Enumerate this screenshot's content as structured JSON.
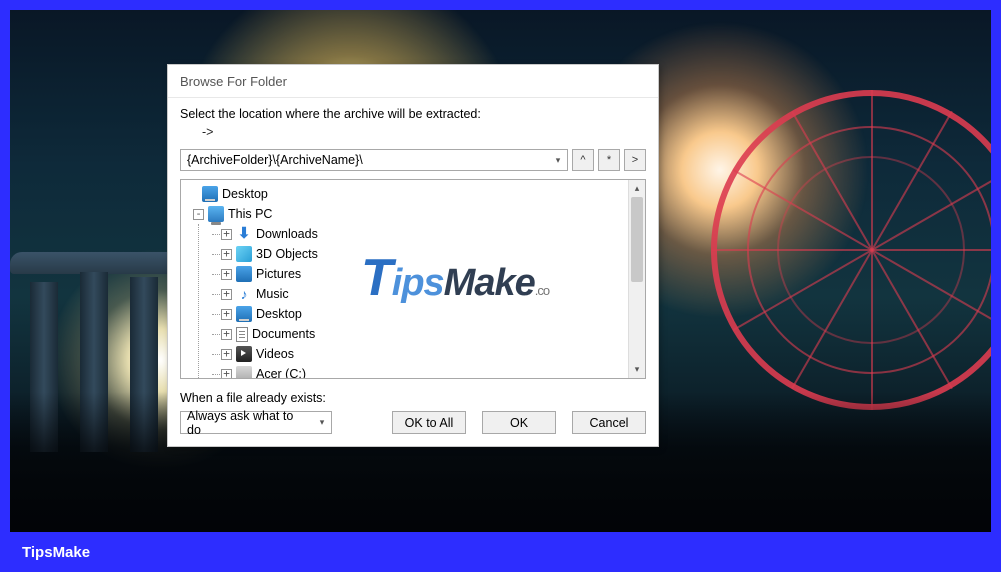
{
  "caption": "TipsMake",
  "watermark": {
    "t": "T",
    "ips": "ips",
    "make": "Make",
    "suffix": ".co"
  },
  "dialog": {
    "title": "Browse For Folder",
    "instruction": "Select the location where the archive will be extracted:",
    "arrow": "->",
    "path_value": "{ArchiveFolder}\\{ArchiveName}\\",
    "path_buttons": {
      "up": "^",
      "star": "*",
      "forward": ">"
    },
    "exists_label": "When a file already exists:",
    "exists_value": "Always ask what to do",
    "buttons": {
      "ok_all": "OK to All",
      "ok": "OK",
      "cancel": "Cancel"
    }
  },
  "tree": {
    "root": {
      "label": "Desktop",
      "expander": "-"
    },
    "thispc": {
      "label": "This PC",
      "expander": "-"
    },
    "items": [
      {
        "label": "Downloads",
        "expander": "+",
        "icon": "download"
      },
      {
        "label": "3D Objects",
        "expander": "+",
        "icon": "3d"
      },
      {
        "label": "Pictures",
        "expander": "+",
        "icon": "pictures"
      },
      {
        "label": "Music",
        "expander": "+",
        "icon": "music"
      },
      {
        "label": "Desktop",
        "expander": "+",
        "icon": "desktop"
      },
      {
        "label": "Documents",
        "expander": "+",
        "icon": "documents"
      },
      {
        "label": "Videos",
        "expander": "+",
        "icon": "videos"
      },
      {
        "label": "Acer (C:)",
        "expander": "+",
        "icon": "drive"
      }
    ]
  }
}
